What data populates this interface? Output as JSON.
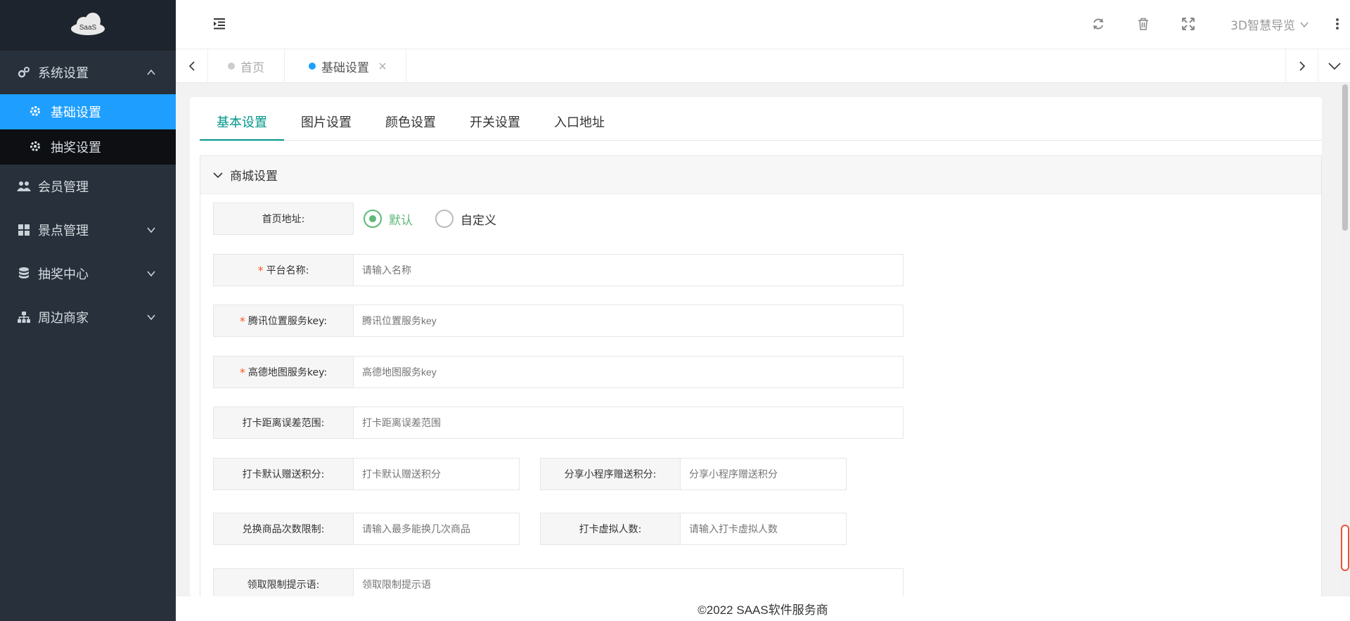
{
  "sidebar": {
    "logo_text": "SaaS",
    "menu": [
      {
        "label": "系统设置",
        "icon": "gears-icon",
        "expanded": true,
        "children": [
          {
            "label": "基础设置",
            "icon": "gear-icon",
            "active": true
          },
          {
            "label": "抽奖设置",
            "icon": "gear-icon",
            "active": false
          }
        ]
      },
      {
        "label": "会员管理",
        "icon": "users-icon"
      },
      {
        "label": "景点管理",
        "icon": "grid-icon"
      },
      {
        "label": "抽奖中心",
        "icon": "database-icon"
      },
      {
        "label": "周边商家",
        "icon": "sitemap-icon"
      }
    ]
  },
  "header": {
    "user_label": "3D智慧导览",
    "icons": [
      "indent-icon",
      "refresh-icon",
      "trash-icon",
      "fullscreen-icon",
      "chevron-down-icon",
      "more-vertical-icon"
    ]
  },
  "page_tabs": [
    {
      "label": "首页",
      "active": false
    },
    {
      "label": "基础设置",
      "active": true,
      "closable": true
    }
  ],
  "content_tabs": [
    "基本设置",
    "图片设置",
    "颜色设置",
    "开关设置",
    "入口地址"
  ],
  "active_content_tab": 0,
  "panel": {
    "title": "商城设置",
    "homepage": {
      "label": "首页地址:",
      "options": [
        "默认",
        "自定义"
      ],
      "selected": "默认"
    },
    "fields": {
      "platform_name": {
        "label": "平台名称:",
        "required": true,
        "placeholder": "请输入名称",
        "value": ""
      },
      "tencent_key": {
        "label": "腾讯位置服务key:",
        "required": true,
        "placeholder": "腾讯位置服务key",
        "value": ""
      },
      "amap_key": {
        "label": "高德地图服务key:",
        "required": true,
        "placeholder": "高德地图服务key",
        "value": ""
      },
      "checkin_range": {
        "label": "打卡距离误差范围:",
        "required": false,
        "placeholder": "打卡距离误差范围",
        "value": ""
      },
      "checkin_points": {
        "label": "打卡默认赠送积分:",
        "required": false,
        "placeholder": "打卡默认赠送积分",
        "value": ""
      },
      "share_points": {
        "label": "分享小程序赠送积分:",
        "required": false,
        "placeholder": "分享小程序赠送积分",
        "value": ""
      },
      "exchange_limit": {
        "label": "兑换商品次数限制:",
        "required": false,
        "placeholder": "请输入最多能换几次商品",
        "value": ""
      },
      "virtual_checkin": {
        "label": "打卡虚拟人数:",
        "required": false,
        "placeholder": "请输入打卡虚拟人数",
        "value": ""
      },
      "limit_tip": {
        "label": "领取限制提示语:",
        "required": false,
        "placeholder": "领取限制提示语",
        "value": ""
      }
    }
  },
  "footer": {
    "text": "©2022 SAAS软件服务商"
  },
  "colors": {
    "sidebar": "#28303b",
    "active": "#1e9fff",
    "tab_active": "#009688",
    "radio": "#5fb878",
    "required": "#ff5722"
  }
}
